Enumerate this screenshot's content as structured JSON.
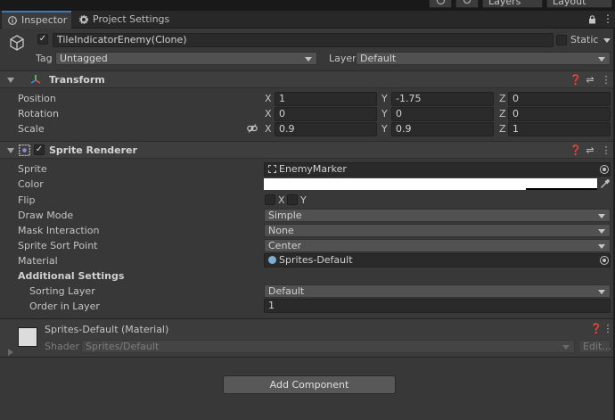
{
  "toolbar": {
    "layers_label": "Layers",
    "layout_label": "Layout"
  },
  "tabs": {
    "inspector": "Inspector",
    "project_settings": "Project Settings"
  },
  "object": {
    "name": "TileIndicatorEnemy(Clone)",
    "static_label": "Static",
    "tag_label": "Tag",
    "tag_value": "Untagged",
    "layer_label": "Layer",
    "layer_value": "Default"
  },
  "transform": {
    "title": "Transform",
    "position_label": "Position",
    "rotation_label": "Rotation",
    "scale_label": "Scale",
    "axis_x": "X",
    "axis_y": "Y",
    "axis_z": "Z",
    "position": {
      "x": "1",
      "y": "-1.75",
      "z": "0"
    },
    "rotation": {
      "x": "0",
      "y": "0",
      "z": "0"
    },
    "scale": {
      "x": "0.9",
      "y": "0.9",
      "z": "1"
    }
  },
  "sprite_renderer": {
    "title": "Sprite Renderer",
    "sprite_label": "Sprite",
    "sprite_value": "EnemyMarker",
    "color_label": "Color",
    "color_value": "#ffffff",
    "flip_label": "Flip",
    "flip_x": "X",
    "flip_y": "Y",
    "draw_mode_label": "Draw Mode",
    "draw_mode_value": "Simple",
    "mask_label": "Mask Interaction",
    "mask_value": "None",
    "sort_point_label": "Sprite Sort Point",
    "sort_point_value": "Center",
    "material_label": "Material",
    "material_value": "Sprites-Default",
    "additional_label": "Additional Settings",
    "sorting_layer_label": "Sorting Layer",
    "sorting_layer_value": "Default",
    "order_label": "Order in Layer",
    "order_value": "1"
  },
  "material": {
    "title": "Sprites-Default (Material)",
    "shader_label": "Shader",
    "shader_value": "Sprites/Default",
    "edit_label": "Edit..."
  },
  "add_component_label": "Add Component",
  "colors": {
    "accent": "#3a79bb",
    "panel": "#383838",
    "field": "#2a2a2a"
  }
}
